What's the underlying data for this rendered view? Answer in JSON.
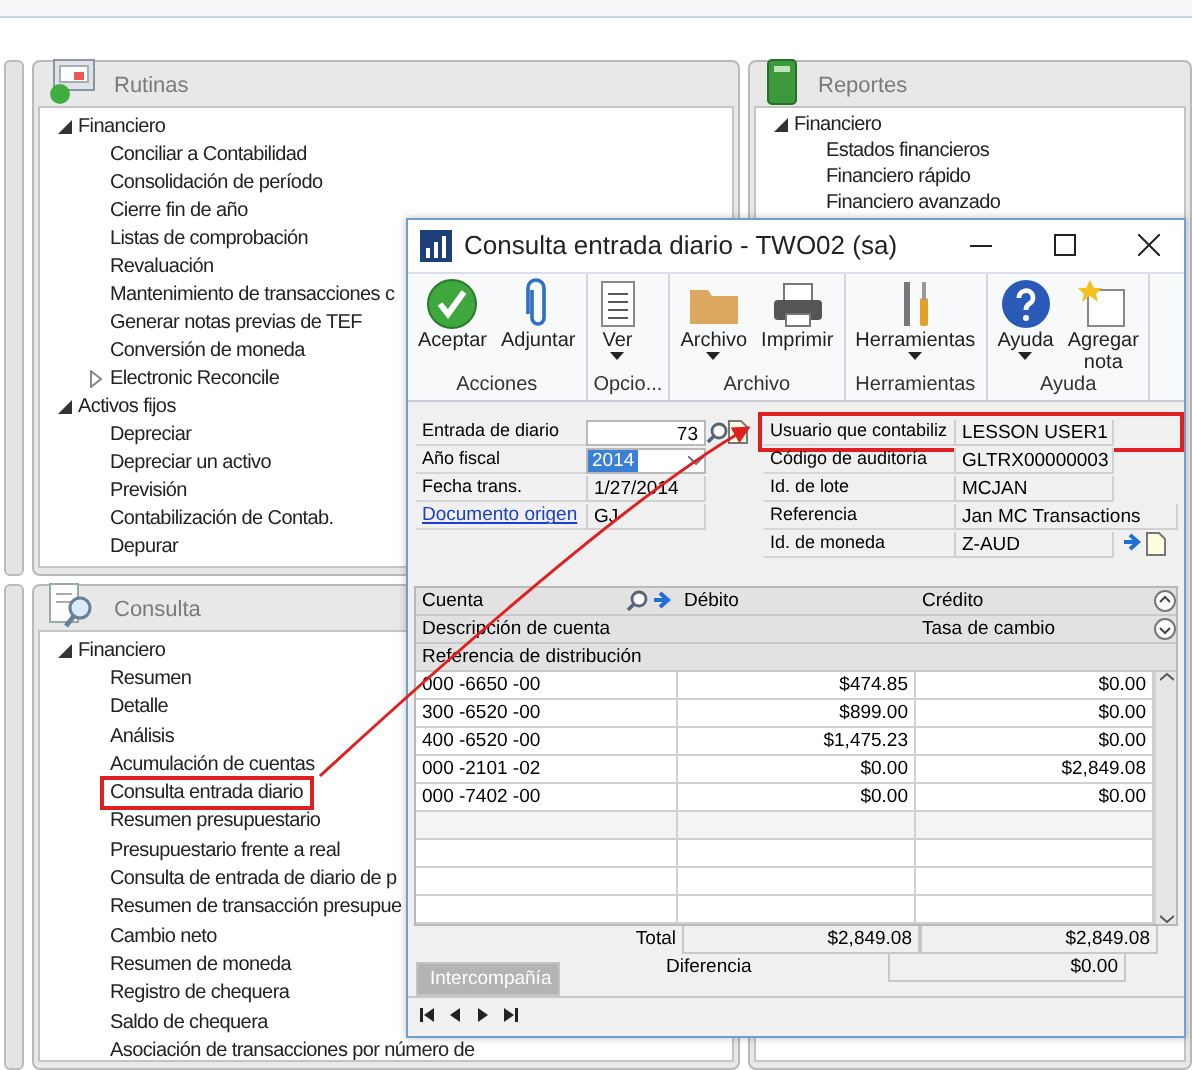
{
  "panels": [
    {
      "title": "Rutinas",
      "tree": [
        {
          "label": "Financiero",
          "expanded": true,
          "children": [
            {
              "label": "Conciliar a Contabilidad"
            },
            {
              "label": "Consolidación de período"
            },
            {
              "label": "Cierre fin de año"
            },
            {
              "label": "Listas de comprobación"
            },
            {
              "label": "Revaluación"
            },
            {
              "label": "Mantenimiento de transacciones c"
            },
            {
              "label": "Generar notas previas de TEF"
            },
            {
              "label": "Conversión de moneda"
            },
            {
              "label": "Electronic Reconcile",
              "expanded": false
            }
          ]
        },
        {
          "label": "Activos fijos",
          "expanded": true,
          "children": [
            {
              "label": "Depreciar"
            },
            {
              "label": "Depreciar un activo"
            },
            {
              "label": "Previsión"
            },
            {
              "label": "Contabilización de Contab."
            },
            {
              "label": "Depurar"
            }
          ]
        }
      ]
    },
    {
      "title": "Reportes",
      "tree": [
        {
          "label": "Financiero",
          "expanded": true,
          "children": [
            {
              "label": "Estados financieros"
            },
            {
              "label": "Financiero rápido"
            },
            {
              "label": "Financiero avanzado"
            }
          ]
        }
      ]
    },
    {
      "title": "Consulta",
      "tree": [
        {
          "label": "Financiero",
          "expanded": true,
          "children": [
            {
              "label": "Resumen",
              "highlighted": false
            },
            {
              "label": "Detalle",
              "highlighted": false
            },
            {
              "label": "Análisis",
              "highlighted": false
            },
            {
              "label": "Acumulación de cuentas",
              "highlighted": false
            },
            {
              "label": "Consulta entrada diario",
              "highlighted": true
            },
            {
              "label": "Resumen presupuestario",
              "highlighted": false
            },
            {
              "label": "Presupuestario frente a real",
              "highlighted": false
            },
            {
              "label": "Consulta de entrada de diario de p",
              "highlighted": false
            },
            {
              "label": "Resumen de transacción presupue",
              "highlighted": false
            },
            {
              "label": "Cambio neto",
              "highlighted": false
            },
            {
              "label": "Resumen de moneda",
              "highlighted": false
            },
            {
              "label": "Registro de chequera",
              "highlighted": false
            },
            {
              "label": "Saldo de chequera",
              "highlighted": false
            },
            {
              "label": "Asociación de transacciones por número de",
              "highlighted": false
            }
          ]
        }
      ]
    }
  ],
  "dialog": {
    "title": "Consulta entrada diario  -  TWO02 (sa)",
    "ribbon": [
      {
        "group": "Acciones",
        "buttons": [
          {
            "label": "Aceptar",
            "menu": false
          },
          {
            "label": "Adjuntar",
            "menu": false
          }
        ]
      },
      {
        "group": "Opcio...",
        "buttons": [
          {
            "label": "Ver",
            "menu": true
          }
        ]
      },
      {
        "group": "Archivo",
        "buttons": [
          {
            "label": "Archivo",
            "menu": true
          },
          {
            "label": "Imprimir",
            "menu": false
          }
        ]
      },
      {
        "group": "Herramientas",
        "buttons": [
          {
            "label": "Herramientas",
            "menu": true
          }
        ]
      },
      {
        "group": "Ayuda",
        "buttons": [
          {
            "label": "Ayuda",
            "menu": true
          },
          {
            "label": "Agregar nota",
            "menu": false
          }
        ]
      }
    ],
    "left_fields": [
      {
        "label": "Entrada de diario",
        "value": "73",
        "kind": "lookup"
      },
      {
        "label": "Año fiscal",
        "value": "2014",
        "kind": "dropdown"
      },
      {
        "label": "Fecha trans.",
        "value": "1/27/2014",
        "kind": "text"
      },
      {
        "label": "Documento origen",
        "value": "GJ",
        "kind": "link"
      }
    ],
    "right_fields": [
      {
        "label": "Usuario que contabiliz",
        "value": "LESSON USER1",
        "kind": "text",
        "highlighted": true
      },
      {
        "label": "Código de auditoría",
        "value": "GLTRX00000003",
        "kind": "text",
        "highlighted": false
      },
      {
        "label": "Id. de lote",
        "value": "MCJAN",
        "kind": "text",
        "highlighted": false
      },
      {
        "label": "Referencia",
        "value": "Jan MC Transactions",
        "kind": "wide",
        "highlighted": false
      },
      {
        "label": "Id. de moneda",
        "value": "Z-AUD",
        "kind": "currency",
        "highlighted": false
      }
    ],
    "grid": {
      "headers": {
        "account": "Cuenta",
        "debit": "Débito",
        "credit": "Crédito",
        "description": "Descripción de cuenta",
        "exchange_rate": "Tasa de cambio",
        "reference": "Referencia de distribución"
      },
      "rows": [
        {
          "account": "000 -6650 -00",
          "debit": "$474.85",
          "credit": "$0.00"
        },
        {
          "account": "300 -6520 -00",
          "debit": "$899.00",
          "credit": "$0.00"
        },
        {
          "account": "400 -6520 -00",
          "debit": "$1,475.23",
          "credit": "$0.00"
        },
        {
          "account": "000 -2101 -02",
          "debit": "$0.00",
          "credit": "$2,849.08"
        },
        {
          "account": "000 -7402 -00",
          "debit": "$0.00",
          "credit": "$0.00"
        }
      ],
      "total": {
        "label": "Total",
        "debit": "$2,849.08",
        "credit": "$2,849.08"
      },
      "difference": {
        "label": "Diferencia",
        "value": "$0.00"
      }
    },
    "intercompany_button": {
      "label": "Intercompañía",
      "disabled": true
    }
  }
}
